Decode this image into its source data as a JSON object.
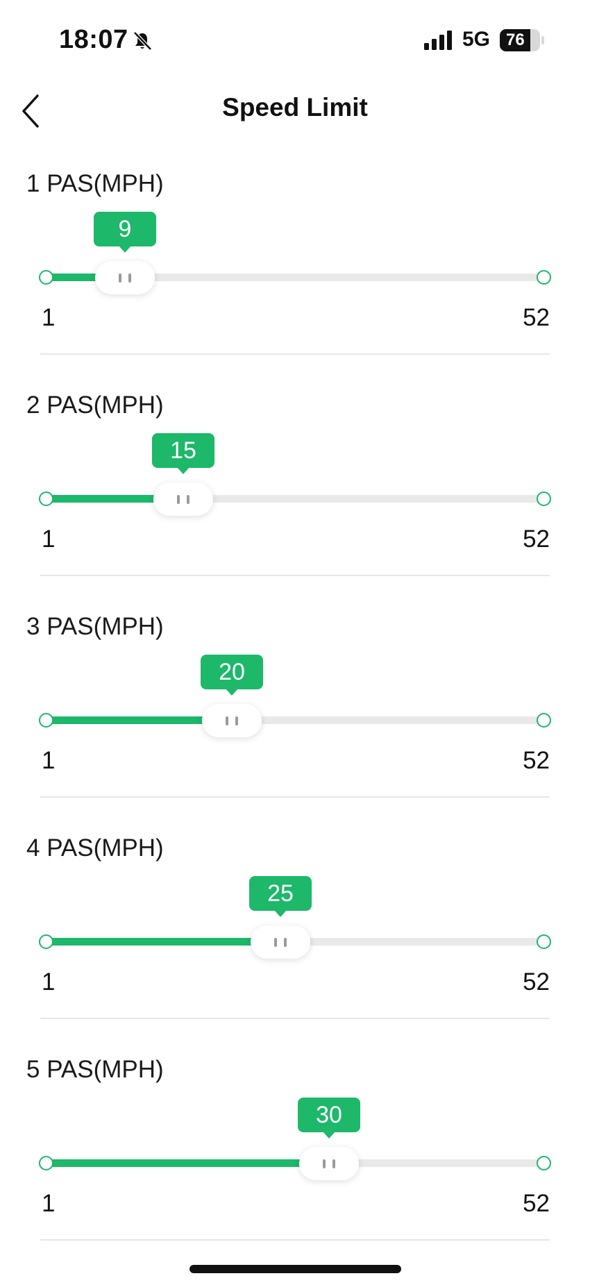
{
  "status_bar": {
    "time": "18:07",
    "network": "5G",
    "battery_level": "76",
    "battery_fraction": 0.76
  },
  "header": {
    "title": "Speed Limit",
    "back_icon": "chevron-left-icon"
  },
  "colors": {
    "accent": "#1db86a",
    "track": "#e9e9e9"
  },
  "speed_limits": [
    {
      "label": "1 PAS(MPH)",
      "value": 9,
      "min": 1,
      "max": 52
    },
    {
      "label": "2 PAS(MPH)",
      "value": 15,
      "min": 1,
      "max": 52
    },
    {
      "label": "3 PAS(MPH)",
      "value": 20,
      "min": 1,
      "max": 52
    },
    {
      "label": "4 PAS(MPH)",
      "value": 25,
      "min": 1,
      "max": 52
    },
    {
      "label": "5 PAS(MPH)",
      "value": 30,
      "min": 1,
      "max": 52
    }
  ]
}
